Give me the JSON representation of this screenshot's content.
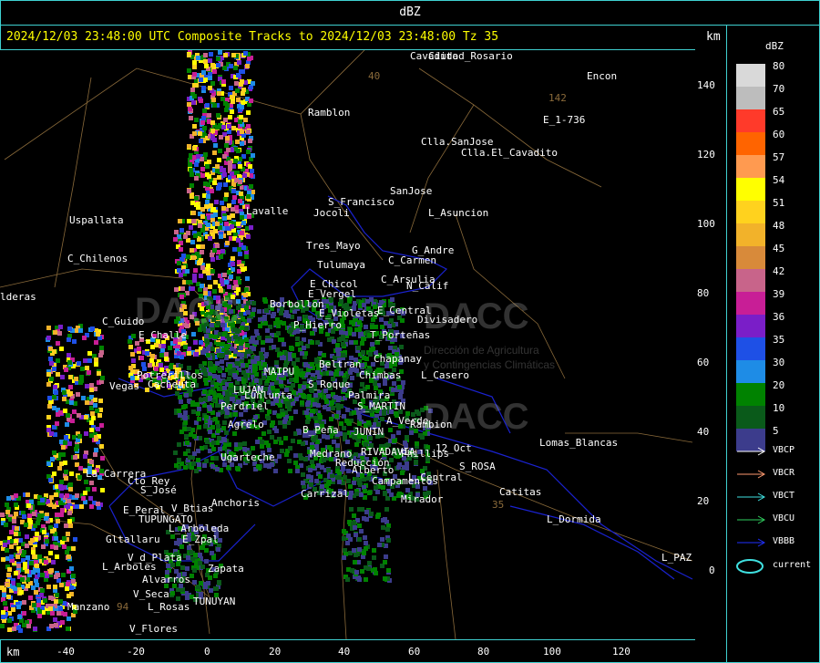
{
  "window": {
    "title": "dBZ"
  },
  "header": {
    "text": "2024/12/03 23:48:00 UTC Composite Tracks to 2024/12/03 23:48:00 Tz 35",
    "km_label": "km"
  },
  "map": {
    "places": [
      {
        "name": "Ramblon"
      },
      {
        "name": "Encon"
      },
      {
        "name": "E_1-736"
      },
      {
        "name": "Clla.SanJose"
      },
      {
        "name": "Clla.El_Cavadito"
      },
      {
        "name": "S_Francisco"
      },
      {
        "name": "SanJose"
      },
      {
        "name": "Jocoli"
      },
      {
        "name": "L_Asuncion"
      },
      {
        "name": "Uspallata"
      },
      {
        "name": "Lavalle"
      },
      {
        "name": "Tres_Mayo"
      },
      {
        "name": "G_Andre"
      },
      {
        "name": "C_Carmen"
      },
      {
        "name": "Tulumaya"
      },
      {
        "name": "C_Chilenos"
      },
      {
        "name": "E_Chicol"
      },
      {
        "name": "C_Arsulia"
      },
      {
        "name": "N_Calif"
      },
      {
        "name": "E_Vergel"
      },
      {
        "name": "Borbollon"
      },
      {
        "name": "E_Central"
      },
      {
        "name": "Divisadero"
      },
      {
        "name": "C_Guido"
      },
      {
        "name": "P_Hierro"
      },
      {
        "name": "E_Violetas"
      },
      {
        "name": "E_Challe"
      },
      {
        "name": "T_Porteñas"
      },
      {
        "name": "Chapanay"
      },
      {
        "name": "Potrerillos"
      },
      {
        "name": "Vegas"
      },
      {
        "name": "Cacheuta"
      },
      {
        "name": "MAIPU"
      },
      {
        "name": "Beltran"
      },
      {
        "name": "Chimbas"
      },
      {
        "name": "Lunlunta"
      },
      {
        "name": "S_Roque"
      },
      {
        "name": "L_Casero"
      },
      {
        "name": "LUJAN"
      },
      {
        "name": "Perdriel"
      },
      {
        "name": "S_MARTIN"
      },
      {
        "name": "Palmira"
      },
      {
        "name": "Agrelo"
      },
      {
        "name": "A_Verde"
      },
      {
        "name": "Rambion"
      },
      {
        "name": "B_Peña"
      },
      {
        "name": "JUNIN"
      },
      {
        "name": "Lomas_Blancas"
      },
      {
        "name": "Ugarteche"
      },
      {
        "name": "Medrano"
      },
      {
        "name": "RIVADAVIA"
      },
      {
        "name": "12_Oct"
      },
      {
        "name": "Phillips"
      },
      {
        "name": "La_Carrera"
      },
      {
        "name": "Reducción"
      },
      {
        "name": "S_ROSA"
      },
      {
        "name": "Cto_Rey"
      },
      {
        "name": "Alberto"
      },
      {
        "name": "L_Central"
      },
      {
        "name": "Campamentos"
      },
      {
        "name": "S_José"
      },
      {
        "name": "Carrizal"
      },
      {
        "name": "Catitas"
      },
      {
        "name": "Anchoris"
      },
      {
        "name": "Mirador"
      },
      {
        "name": "E_Peral"
      },
      {
        "name": "V_Btias"
      },
      {
        "name": "TUPUNGATO"
      },
      {
        "name": "L_Arboleda"
      },
      {
        "name": "L_Dormida"
      },
      {
        "name": "Gltallaru"
      },
      {
        "name": "E_Zpal"
      },
      {
        "name": "V_d_Plata"
      },
      {
        "name": "L_Arboles"
      },
      {
        "name": "Zapata"
      },
      {
        "name": "Alvarros"
      },
      {
        "name": "L_PAZ"
      },
      {
        "name": "V_Seca"
      },
      {
        "name": "TUNUYAN"
      },
      {
        "name": "Manzano"
      },
      {
        "name": "L_Rosas"
      },
      {
        "name": "V_Flores"
      },
      {
        "name": "Ciudad_Rosario"
      },
      {
        "name": "Cavadito"
      },
      {
        "name": "lderas"
      },
      {
        "name": "142"
      },
      {
        "name": "94"
      },
      {
        "name": "40"
      },
      {
        "name": "35"
      }
    ],
    "watermark": "DACC",
    "watermark_sub1": "Dirección de Agricultura",
    "watermark_sub2": "y Contingencias Climáticas"
  },
  "axes": {
    "y_ticks": [
      "140",
      "120",
      "100",
      "80",
      "60",
      "40",
      "20",
      "0"
    ],
    "x_ticks": [
      "-40",
      "-20",
      "0",
      "20",
      "40",
      "60",
      "80",
      "100",
      "120"
    ],
    "km_bottom": "km"
  },
  "legend": {
    "title": "dBZ",
    "levels": [
      {
        "label": "80",
        "color": "#d9d9d9"
      },
      {
        "label": "70",
        "color": "#bdbdbd"
      },
      {
        "label": "65",
        "color": "#ff3a2a"
      },
      {
        "label": "60",
        "color": "#ff6400"
      },
      {
        "label": "57",
        "color": "#ff9a50"
      },
      {
        "label": "54",
        "color": "#ffff00"
      },
      {
        "label": "51",
        "color": "#ffd21e"
      },
      {
        "label": "48",
        "color": "#f2b22a"
      },
      {
        "label": "45",
        "color": "#d88a3a"
      },
      {
        "label": "42",
        "color": "#c8648a"
      },
      {
        "label": "39",
        "color": "#c81e96"
      },
      {
        "label": "36",
        "color": "#7a1ec8"
      },
      {
        "label": "35",
        "color": "#1e50e6"
      },
      {
        "label": "30",
        "color": "#1e8ce6"
      },
      {
        "label": "20",
        "color": "#008200"
      },
      {
        "label": "10",
        "color": "#0a5a1a"
      },
      {
        "label": "5",
        "color": "#3c3c8c"
      }
    ],
    "tracks": [
      {
        "label": "VBCP",
        "color": "#ffffff"
      },
      {
        "label": "VBCR",
        "color": "#ff9a70"
      },
      {
        "label": "VBCT",
        "color": "#3fe0e0"
      },
      {
        "label": "VBCU",
        "color": "#30d060"
      },
      {
        "label": "VBBB",
        "color": "#2030ff"
      }
    ],
    "current_label": "current",
    "current_color": "#3fe0e0"
  }
}
